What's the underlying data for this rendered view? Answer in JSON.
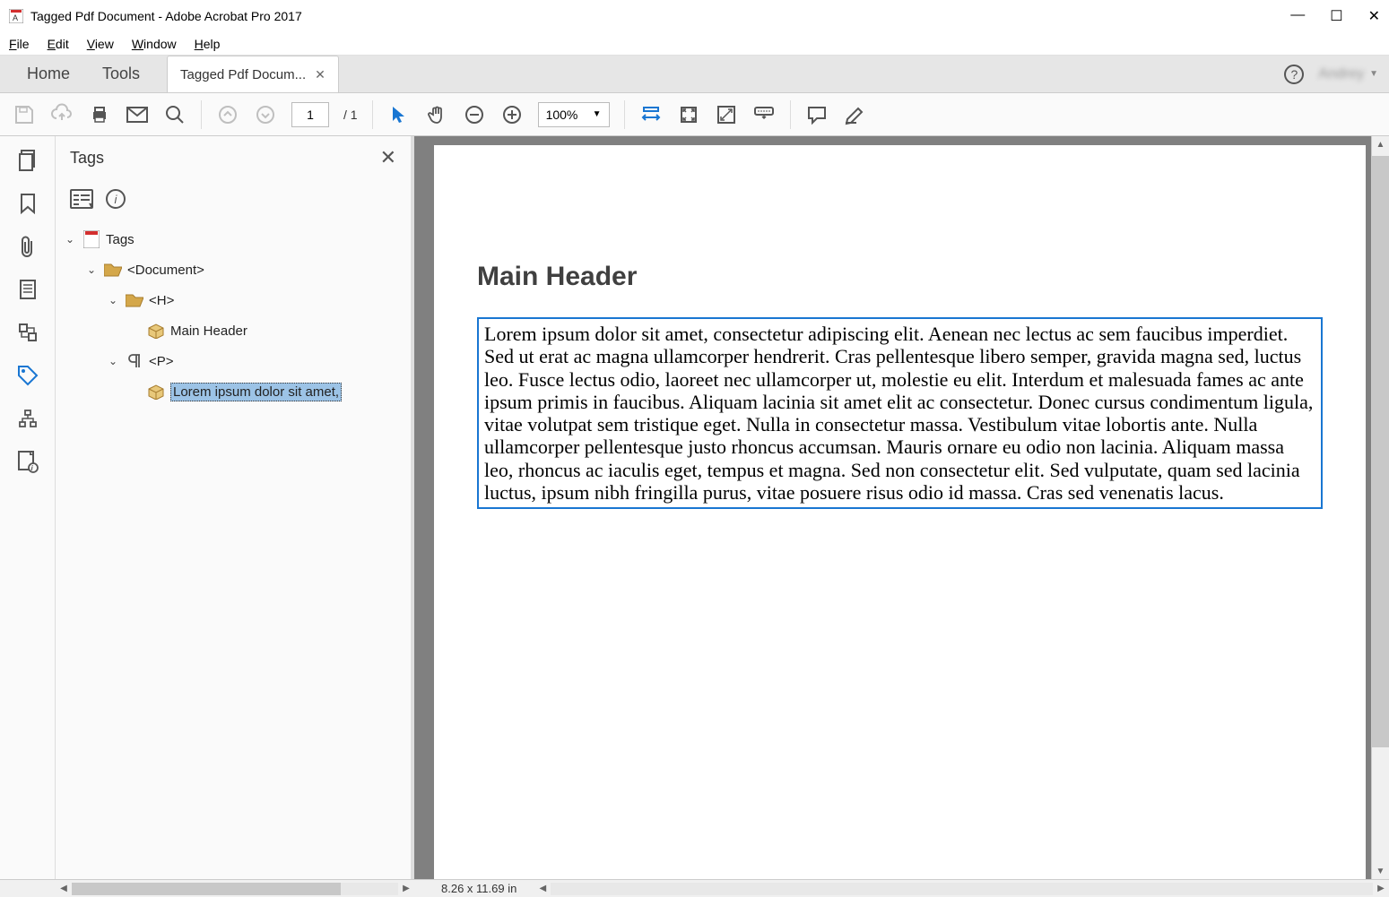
{
  "window": {
    "title": "Tagged Pdf Document - Adobe Acrobat Pro 2017"
  },
  "menu": {
    "file": "File",
    "edit": "Edit",
    "view": "View",
    "window": "Window",
    "help": "Help"
  },
  "tabs": {
    "home": "Home",
    "tools": "Tools",
    "doc": "Tagged Pdf Docum...",
    "user": "Andrey"
  },
  "toolbar": {
    "page_current": "1",
    "page_total": "/ 1",
    "zoom": "100%"
  },
  "tags_panel": {
    "title": "Tags",
    "tree": {
      "root": "Tags",
      "doc": "<Document>",
      "h": "<H>",
      "h_content": "Main Header",
      "p": "<P>",
      "p_content": "Lorem ipsum dolor sit amet,"
    }
  },
  "document": {
    "header": "Main Header",
    "paragraph": "Lorem ipsum dolor sit amet, consectetur adipiscing elit. Aenean nec lectus ac sem faucibus imperdiet. Sed ut erat ac magna ullamcorper hendrerit. Cras pellentesque libero semper, gravida magna sed, luctus leo. Fusce lectus odio, laoreet nec ullamcorper ut, molestie eu elit. Interdum et malesuada fames ac ante ipsum primis in faucibus. Aliquam lacinia sit amet elit ac consectetur. Donec cursus condimentum ligula, vitae volutpat sem tristique eget. Nulla in consectetur massa. Vestibulum vitae lobortis ante. Nulla ullamcorper pellentesque justo rhoncus accumsan. Mauris ornare eu odio non lacinia. Aliquam massa leo, rhoncus ac iaculis eget, tempus et magna. Sed non consectetur elit. Sed vulputate, quam sed lacinia luctus, ipsum nibh fringilla purus, vitae posuere risus odio id massa. Cras sed venenatis lacus."
  },
  "status": {
    "dimensions": "8.26 x 11.69 in"
  }
}
